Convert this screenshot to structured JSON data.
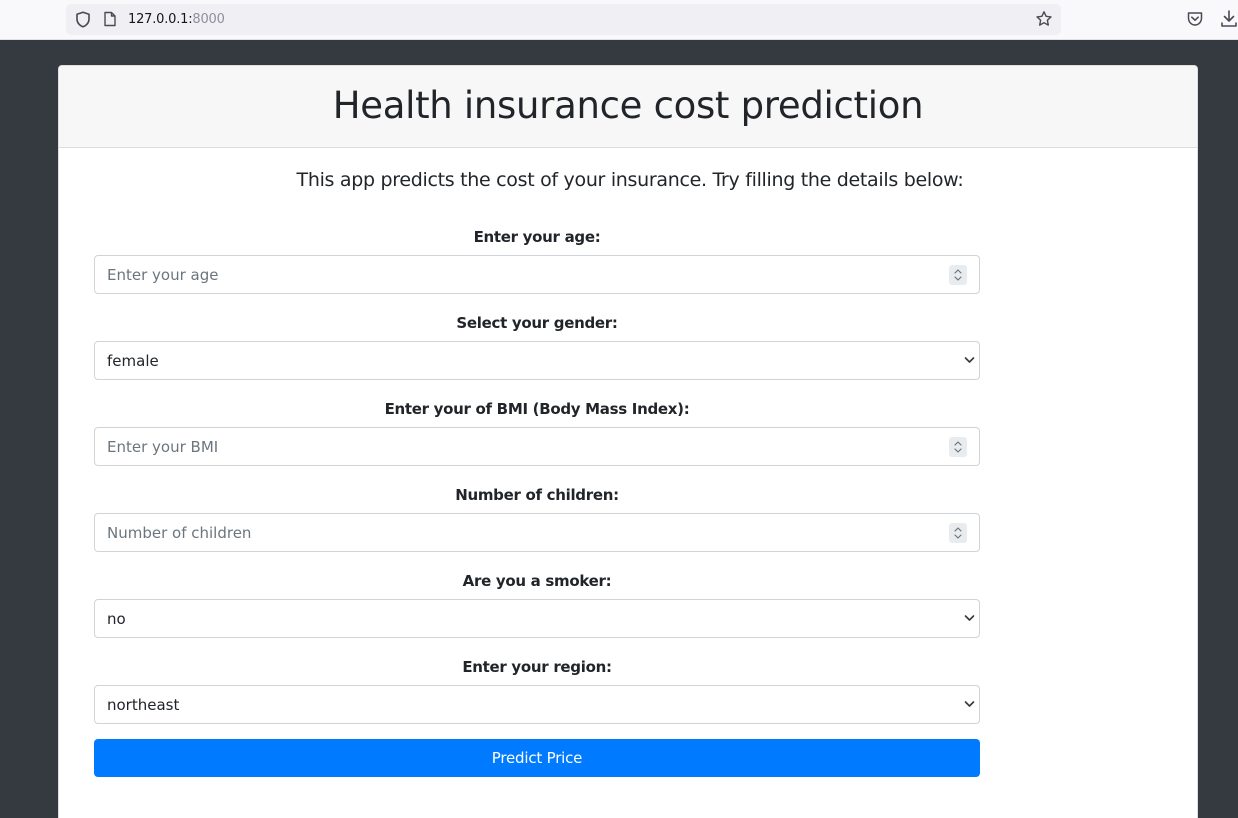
{
  "browser": {
    "url_host": "127.0.0.1:",
    "url_port": "8000"
  },
  "header": {
    "title": "Health insurance cost prediction"
  },
  "intro": "This app predicts the cost of your insurance. Try filling the details below:",
  "form": {
    "age": {
      "label": "Enter your age:",
      "placeholder": "Enter your age",
      "value": ""
    },
    "gender": {
      "label": "Select your gender:",
      "value": "female"
    },
    "bmi": {
      "label": "Enter your of BMI (Body Mass Index):",
      "placeholder": "Enter your BMI",
      "value": ""
    },
    "children": {
      "label": "Number of children:",
      "placeholder": "Number of children",
      "value": ""
    },
    "smoker": {
      "label": "Are you a smoker:",
      "value": "no"
    },
    "region": {
      "label": "Enter your region:",
      "value": "northeast"
    },
    "submit_label": "Predict Price"
  },
  "colors": {
    "page_bg": "#343a40",
    "primary": "#007bff",
    "header_bg": "#f7f7f7"
  },
  "icons": {
    "shield": "tracking-protection-shield-icon",
    "page": "page-info-icon",
    "star": "bookmark-star-icon",
    "pocket": "pocket-icon",
    "download": "download-icon",
    "spinner": "number-spinner-icon",
    "chevron": "chevron-down-icon"
  }
}
